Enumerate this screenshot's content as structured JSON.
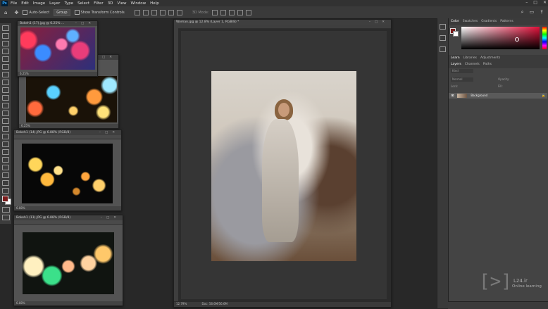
{
  "menu": {
    "app_icon": "Ps",
    "items": [
      "File",
      "Edit",
      "Image",
      "Layer",
      "Type",
      "Select",
      "Filter",
      "3D",
      "View",
      "Window",
      "Help"
    ]
  },
  "options": {
    "auto_select": "Auto-Select",
    "group": "Group",
    "transform_controls": "Show Transform Controls",
    "mode_3d": "3D Mode:"
  },
  "docs": {
    "bokeh1": {
      "title": "Bokeh1 (17).jpg @ 6.25% ...",
      "zoom": "6.25%"
    },
    "bokeh2": {
      "title": "",
      "zoom": "6.25%"
    },
    "bokeh3": {
      "title": "Bokeh1 (14).JPG @ 6.88% (RGB/8)",
      "zoom": "6.88%"
    },
    "bokeh4": {
      "title": "Bokeh1 (11).JPG @ 6.88% (RGB/8)",
      "zoom": "6.88%"
    },
    "main": {
      "title": "Woman.jpg @ 12.8% (Layer 1, RGB/8) *",
      "zoom": "12.79%",
      "doc_info": "Doc: 56.6M/56.6M"
    }
  },
  "color_panel": {
    "tabs": [
      "Color",
      "Swatches",
      "Gradients",
      "Patterns"
    ],
    "fg_color": "#7b1c1c"
  },
  "learn_panel": {
    "tabs": [
      "Learn",
      "Libraries",
      "Adjustments"
    ]
  },
  "layers_panel": {
    "tabs": [
      "Layers",
      "Channels",
      "Paths"
    ],
    "kind": "Kind",
    "normal": "Normal",
    "opacity": "Opacity:",
    "lock": "Lock:",
    "fill": "Fill:",
    "layer_name": "Background"
  },
  "watermark": {
    "brand": "L24.ir",
    "sub": "Online learning"
  }
}
